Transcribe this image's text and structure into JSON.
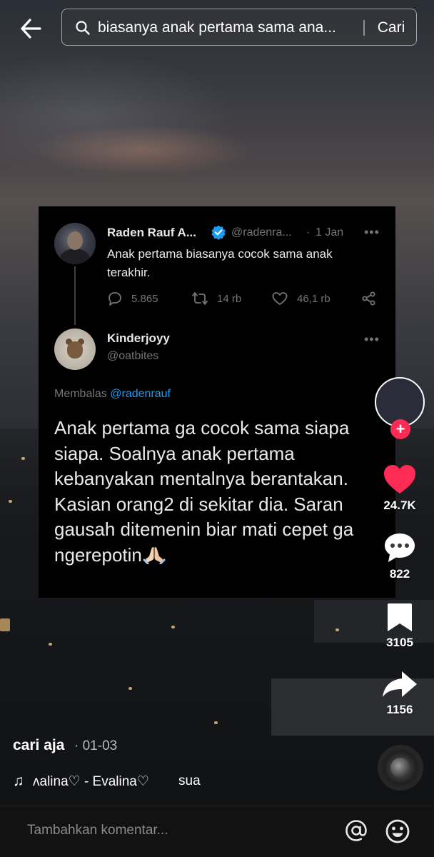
{
  "search": {
    "query": "biasanya anak pertama sama ana...",
    "submit_label": "Cari"
  },
  "tweet_original": {
    "name": "Raden Rauf A...",
    "handle": "@radenra...",
    "separator": "·",
    "time": "1 Jan",
    "text": "Anak pertama biasanya cocok sama anak terakhir.",
    "replies": "5.865",
    "retweets": "14 rb",
    "likes": "46,1 rb"
  },
  "tweet_reply": {
    "name": "Kinderjoyy",
    "handle": "@oatbites",
    "replying_prefix": "Membalas",
    "replying_to": "@radenrauf",
    "text": "Anak pertama ga cocok sama siapa siapa. Soalnya anak pertama kebanyakan mentalnya berantakan. Kasian orang2 di sekitar dia. Saran gausah ditemenin biar mati cepet ga ngerepotin"
  },
  "rail": {
    "follow_label": "+",
    "likes": "24.7K",
    "comments": "822",
    "saves": "3105",
    "shares": "1156"
  },
  "post": {
    "author": "cari aja",
    "date": "· 01-03",
    "music_note": "♫",
    "music_title": "ʌalina♡ - Evalina♡",
    "music_extra": "sua"
  },
  "comment_bar": {
    "placeholder": "Tambahkan komentar..."
  },
  "colors": {
    "accent_red": "#fe2c55",
    "twitter_blue": "#1d9bf0",
    "muted_gray": "#71767b"
  }
}
